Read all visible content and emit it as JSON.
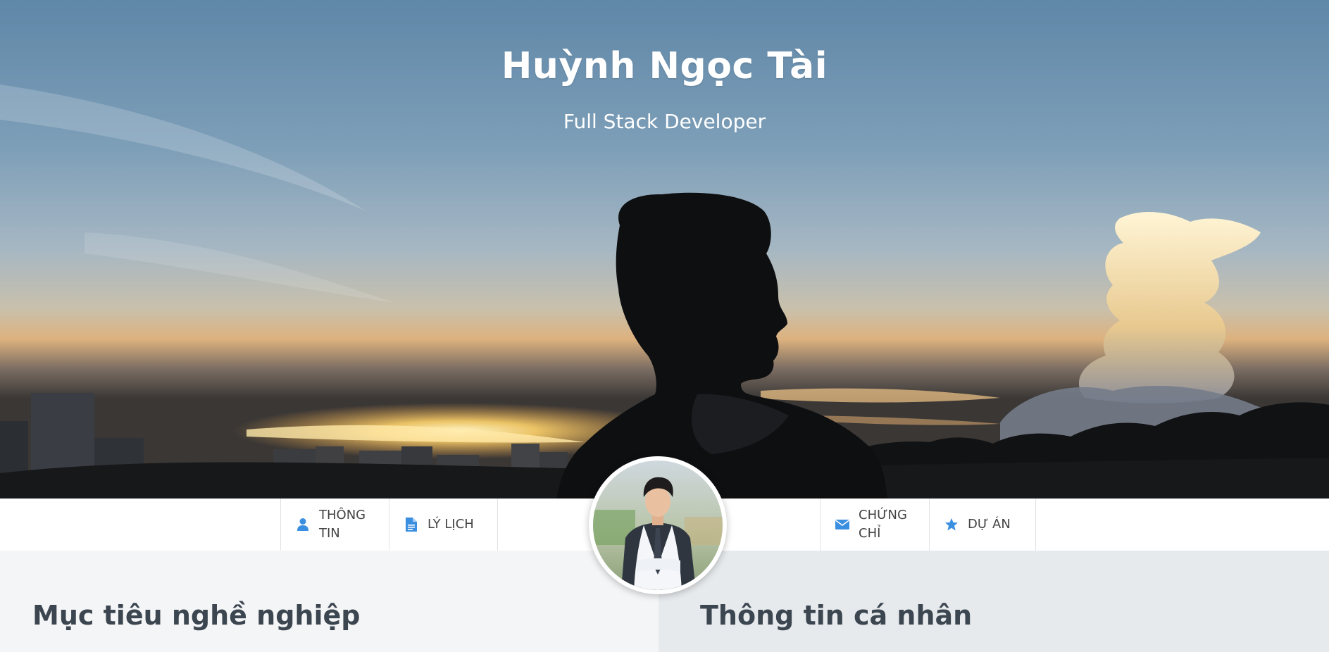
{
  "hero": {
    "name": "Huỳnh Ngọc Tài",
    "role": "Full Stack Developer"
  },
  "nav": {
    "items": [
      {
        "label": "THÔNG TIN",
        "icon": "user-icon"
      },
      {
        "label": "LÝ LỊCH",
        "icon": "document-icon"
      },
      {
        "label": "CHỨNG CHỈ",
        "icon": "envelope-icon"
      },
      {
        "label": "DỰ ÁN",
        "icon": "star-icon"
      }
    ]
  },
  "sections": {
    "left_title": "Mục tiêu nghề nghiệp",
    "right_title": "Thông tin cá nhân"
  },
  "colors": {
    "accent": "#3b8fe0",
    "heading": "#3c4650"
  }
}
